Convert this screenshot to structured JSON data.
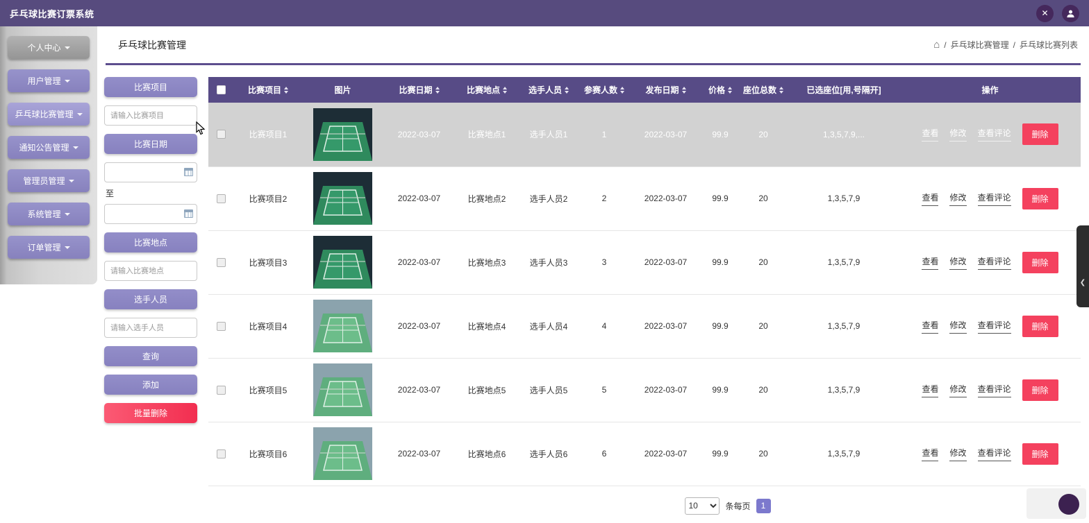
{
  "app": {
    "title": "乒乓球比赛订票系统"
  },
  "icons": {
    "close": "✕",
    "home": "⌂"
  },
  "colors": {
    "header_bar": "#574b7e",
    "accent": "#574b86",
    "danger": "#f4415e"
  },
  "sidebar": {
    "items": [
      {
        "label": "个人中心",
        "variant": "gray"
      },
      {
        "label": "用户管理",
        "variant": "purple"
      },
      {
        "label": "乒乓球比赛管理",
        "variant": "active"
      },
      {
        "label": "通知公告管理",
        "variant": "purple"
      },
      {
        "label": "管理员管理",
        "variant": "purple"
      },
      {
        "label": "系统管理",
        "variant": "purple"
      },
      {
        "label": "订单管理",
        "variant": "purple"
      }
    ]
  },
  "page": {
    "title": "乒乓球比赛管理",
    "breadcrumb": {
      "separator": "/",
      "section": "乒乓球比赛管理",
      "current": "乒乓球比赛列表"
    }
  },
  "filters": {
    "project_label": "比赛项目",
    "project_placeholder": "请输入比赛项目",
    "date_label": "比赛日期",
    "date_to_label": "至",
    "location_label": "比赛地点",
    "location_placeholder": "请输入比赛地点",
    "players_label": "选手人员",
    "players_placeholder": "请输入选手人员",
    "search_label": "查询",
    "add_label": "添加",
    "batch_delete_label": "批量删除"
  },
  "table": {
    "headers": [
      {
        "label": "比赛项目",
        "sortable": true
      },
      {
        "label": "图片",
        "sortable": false
      },
      {
        "label": "比赛日期",
        "sortable": true
      },
      {
        "label": "比赛地点",
        "sortable": true
      },
      {
        "label": "选手人员",
        "sortable": true
      },
      {
        "label": "参赛人数",
        "sortable": true
      },
      {
        "label": "发布日期",
        "sortable": true
      },
      {
        "label": "价格",
        "sortable": true
      },
      {
        "label": "座位总数",
        "sortable": true
      },
      {
        "label": "已选座位[用,号隔开]",
        "sortable": false
      },
      {
        "label": "操作",
        "sortable": false
      }
    ],
    "actions": {
      "view": "查看",
      "edit": "修改",
      "comments": "查看评论",
      "delete": "删除"
    },
    "rows": [
      {
        "project": "比赛项目1",
        "image": "badminton-court-photo",
        "date": "2022-03-07",
        "location": "比赛地点1",
        "players": "选手人员1",
        "participants": "1",
        "publish_date": "2022-03-07",
        "price": "99.9",
        "total_seats": "20",
        "selected_seats": "1,3,5,7,9,...",
        "highlighted": true
      },
      {
        "project": "比赛项目2",
        "image": "badminton-court-photo",
        "date": "2022-03-07",
        "location": "比赛地点2",
        "players": "选手人员2",
        "participants": "2",
        "publish_date": "2022-03-07",
        "price": "99.9",
        "total_seats": "20",
        "selected_seats": "1,3,5,7,9",
        "highlighted": false
      },
      {
        "project": "比赛项目3",
        "image": "badminton-court-photo",
        "date": "2022-03-07",
        "location": "比赛地点3",
        "players": "选手人员3",
        "participants": "3",
        "publish_date": "2022-03-07",
        "price": "99.9",
        "total_seats": "20",
        "selected_seats": "1,3,5,7,9",
        "highlighted": false
      },
      {
        "project": "比赛项目4",
        "image": "badminton-court-photo",
        "date": "2022-03-07",
        "location": "比赛地点4",
        "players": "选手人员4",
        "participants": "4",
        "publish_date": "2022-03-07",
        "price": "99.9",
        "total_seats": "20",
        "selected_seats": "1,3,5,7,9",
        "highlighted": false
      },
      {
        "project": "比赛项目5",
        "image": "badminton-court-photo",
        "date": "2022-03-07",
        "location": "比赛地点5",
        "players": "选手人员5",
        "participants": "5",
        "publish_date": "2022-03-07",
        "price": "99.9",
        "total_seats": "20",
        "selected_seats": "1,3,5,7,9",
        "highlighted": false
      },
      {
        "project": "比赛项目6",
        "image": "badminton-court-photo",
        "date": "2022-03-07",
        "location": "比赛地点6",
        "players": "选手人员6",
        "participants": "6",
        "publish_date": "2022-03-07",
        "price": "99.9",
        "total_seats": "20",
        "selected_seats": "1,3,5,7,9",
        "highlighted": false
      }
    ]
  },
  "pagination": {
    "page_size": "10",
    "per_page_label": "条每页",
    "current_page": "1"
  }
}
